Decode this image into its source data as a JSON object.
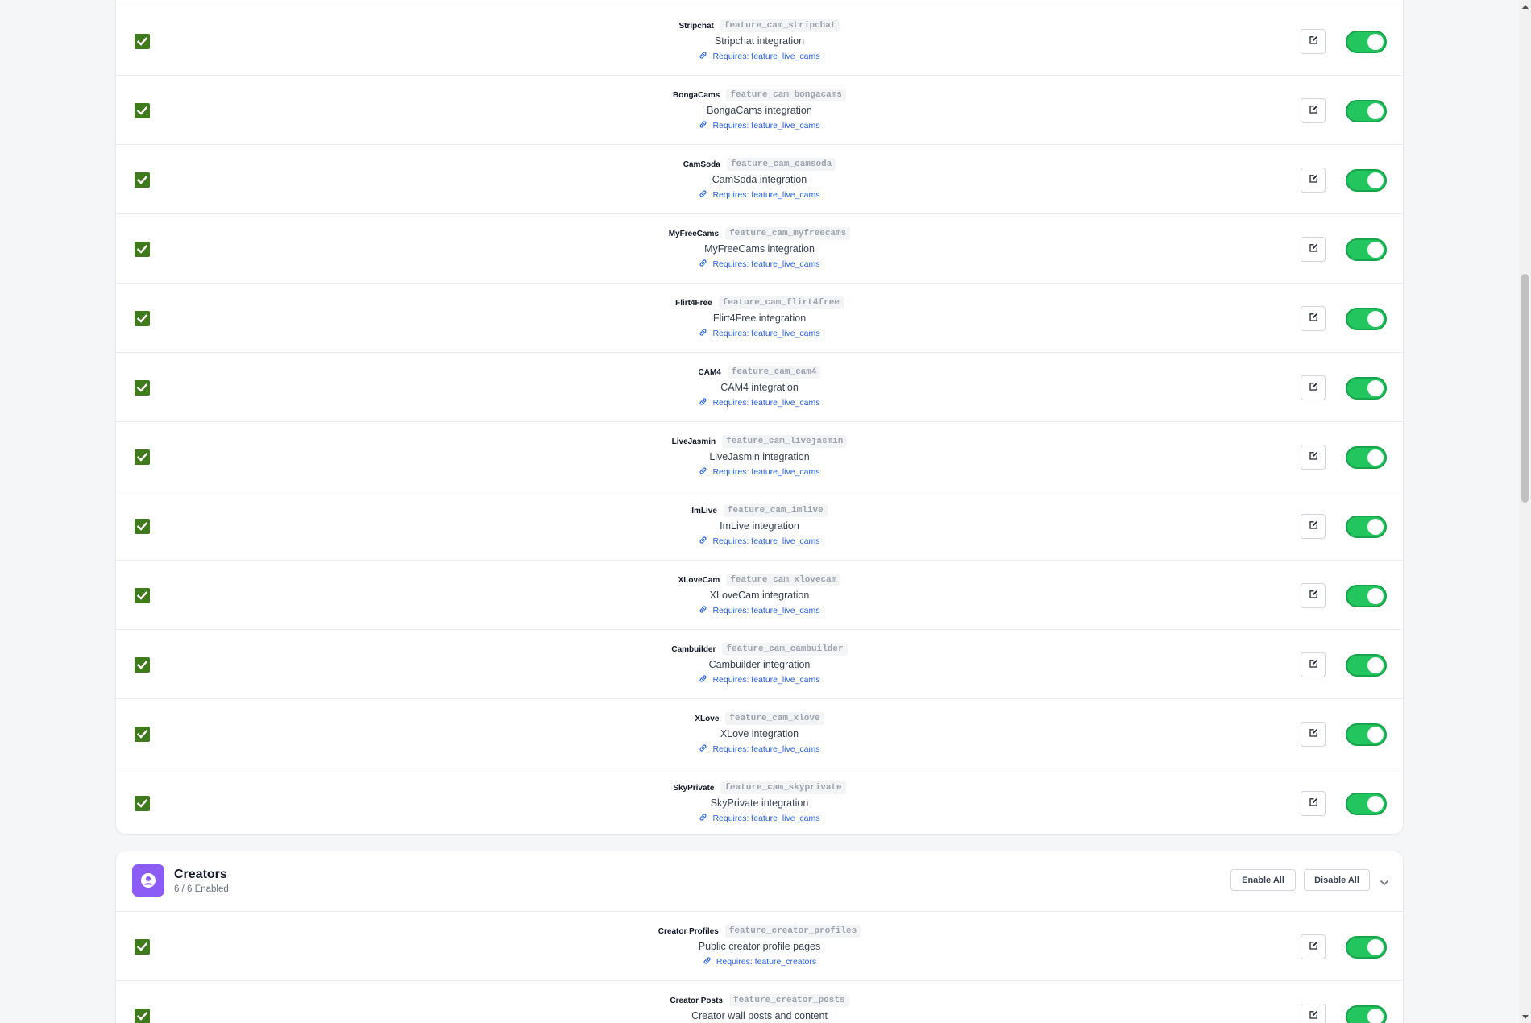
{
  "colors": {
    "accent_toggle": "#22c55e",
    "checkbox": "#3f7a1c",
    "link": "#2563eb",
    "section_icon": "#8b5cf6"
  },
  "cams": [
    {
      "name": "Stripchat",
      "key": "feature_cam_stripchat",
      "desc": "Stripchat integration",
      "requires": "Requires: feature_live_cams",
      "enabled": true,
      "checked": true
    },
    {
      "name": "BongaCams",
      "key": "feature_cam_bongacams",
      "desc": "BongaCams integration",
      "requires": "Requires: feature_live_cams",
      "enabled": true,
      "checked": true
    },
    {
      "name": "CamSoda",
      "key": "feature_cam_camsoda",
      "desc": "CamSoda integration",
      "requires": "Requires: feature_live_cams",
      "enabled": true,
      "checked": true
    },
    {
      "name": "MyFreeCams",
      "key": "feature_cam_myfreecams",
      "desc": "MyFreeCams integration",
      "requires": "Requires: feature_live_cams",
      "enabled": true,
      "checked": true
    },
    {
      "name": "Flirt4Free",
      "key": "feature_cam_flirt4free",
      "desc": "Flirt4Free integration",
      "requires": "Requires: feature_live_cams",
      "enabled": true,
      "checked": true
    },
    {
      "name": "CAM4",
      "key": "feature_cam_cam4",
      "desc": "CAM4 integration",
      "requires": "Requires: feature_live_cams",
      "enabled": true,
      "checked": true
    },
    {
      "name": "LiveJasmin",
      "key": "feature_cam_livejasmin",
      "desc": "LiveJasmin integration",
      "requires": "Requires: feature_live_cams",
      "enabled": true,
      "checked": true
    },
    {
      "name": "ImLive",
      "key": "feature_cam_imlive",
      "desc": "ImLive integration",
      "requires": "Requires: feature_live_cams",
      "enabled": true,
      "checked": true
    },
    {
      "name": "XLoveCam",
      "key": "feature_cam_xlovecam",
      "desc": "XLoveCam integration",
      "requires": "Requires: feature_live_cams",
      "enabled": true,
      "checked": true
    },
    {
      "name": "Cambuilder",
      "key": "feature_cam_cambuilder",
      "desc": "Cambuilder integration",
      "requires": "Requires: feature_live_cams",
      "enabled": true,
      "checked": true
    },
    {
      "name": "XLove",
      "key": "feature_cam_xlove",
      "desc": "XLove integration",
      "requires": "Requires: feature_live_cams",
      "enabled": true,
      "checked": true
    },
    {
      "name": "SkyPrivate",
      "key": "feature_cam_skyprivate",
      "desc": "SkyPrivate integration",
      "requires": "Requires: feature_live_cams",
      "enabled": true,
      "checked": true
    }
  ],
  "creators": {
    "title": "Creators",
    "count": "6 / 6 Enabled",
    "icon": "user-circle-icon",
    "enable_all": "Enable All",
    "disable_all": "Disable All",
    "rows": [
      {
        "name": "Creator Profiles",
        "key": "feature_creator_profiles",
        "desc": "Public creator profile pages",
        "requires": "Requires: feature_creators",
        "enabled": true,
        "checked": true
      },
      {
        "name": "Creator Posts",
        "key": "feature_creator_posts",
        "desc": "Creator wall posts and content",
        "requires": "",
        "enabled": true,
        "checked": true
      }
    ]
  }
}
